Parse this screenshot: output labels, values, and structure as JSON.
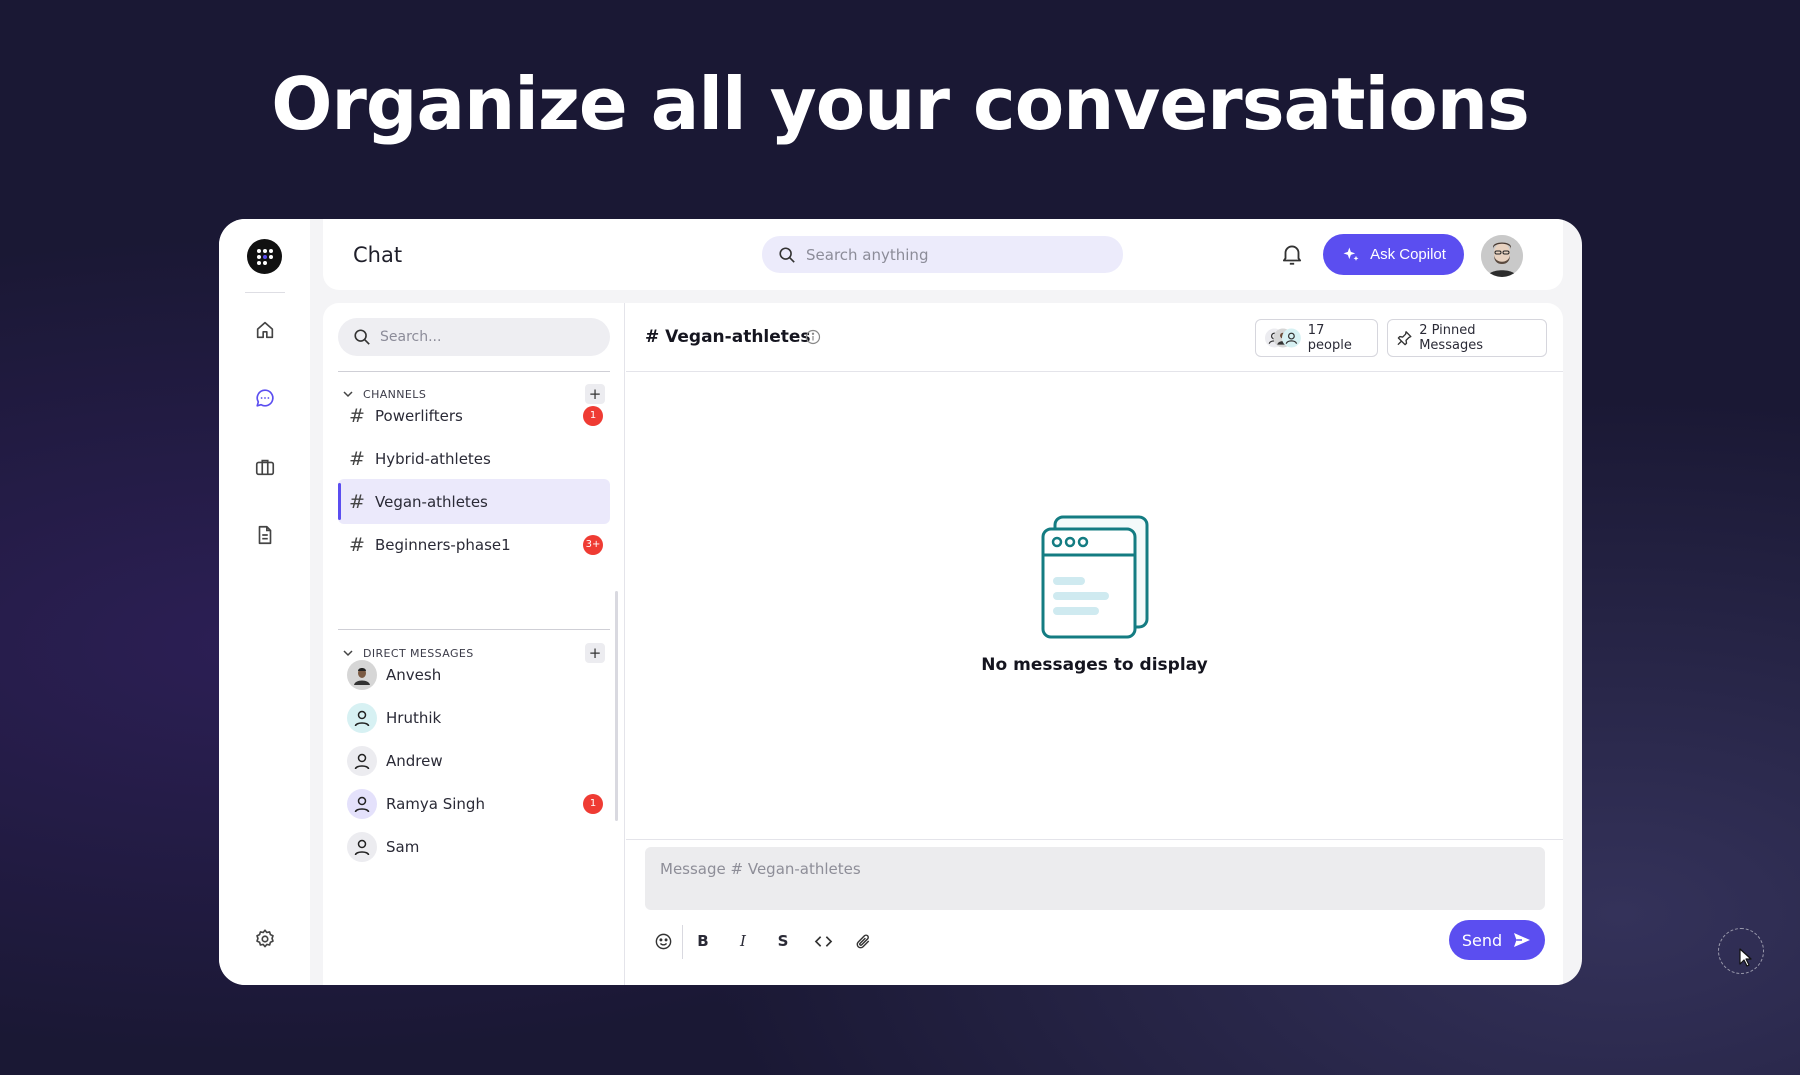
{
  "hero": {
    "title": "Organize all your conversations"
  },
  "topbar": {
    "title": "Chat",
    "search_placeholder": "Search anything",
    "copilot_label": "Ask Copilot"
  },
  "sidebar": {
    "search_placeholder": "Search...",
    "channels_label": "CHANNELS",
    "channels": [
      {
        "name": "Powerlifters",
        "badge": "1"
      },
      {
        "name": "Hybrid-athletes",
        "badge": ""
      },
      {
        "name": "Vegan-athletes",
        "badge": "",
        "active": true
      },
      {
        "name": "Beginners-phase1",
        "badge": "3+"
      }
    ],
    "dm_label": "DIRECT MESSAGES",
    "direct_messages": [
      {
        "name": "Anvesh",
        "badge": ""
      },
      {
        "name": "Hruthik",
        "badge": ""
      },
      {
        "name": "Andrew",
        "badge": ""
      },
      {
        "name": "Ramya Singh",
        "badge": "1"
      },
      {
        "name": "Sam",
        "badge": ""
      }
    ]
  },
  "chat": {
    "channel_title": "# Vegan-athletes",
    "people_label": "17 people",
    "pinned_label": "2 Pinned Messages",
    "empty_text": "No messages to display",
    "composer_placeholder": "Message # Vegan-athletes",
    "send_label": "Send",
    "tools": {
      "bold": "B",
      "italic": "I",
      "strike": "S"
    }
  },
  "colors": {
    "accent": "#5b4ef0",
    "badge": "#ef3b33",
    "illustration": "#147c82"
  }
}
